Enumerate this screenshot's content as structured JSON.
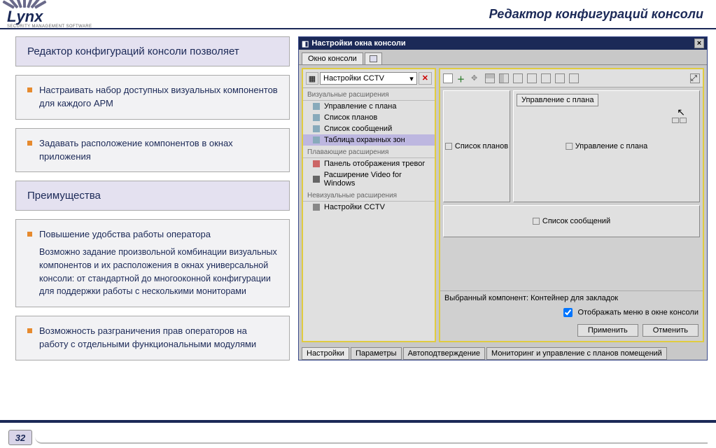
{
  "header": {
    "logo_text": "Lynx",
    "logo_sub": "SECURITY MANAGEMENT SOFTWARE",
    "title": "Редактор конфигураций консоли"
  },
  "intro_panel": "Редактор конфигураций консоли позволяет",
  "feature1": "Настраивать набор доступных визуальных компонентов для каждого АРМ",
  "feature2": "Задавать расположение компонентов в окнах приложения",
  "advantages_title": "Преимущества",
  "adv1_title": "Повышение удобства работы оператора",
  "adv1_body": "Возможно задание произвольной комбинации визуальных компонентов и их расположения в окнах универсальной консоли: от стандартной до многооконной конфигурации для поддержки работы с несколькими мониторами",
  "adv2": "Возможность разграничения прав операторов на работу с отдельными функциональными модулями",
  "app": {
    "title": "Настройки окна консоли",
    "top_tabs": {
      "t1": "Окно консоли"
    },
    "dropdown": "Настройки CCTV",
    "sections": {
      "visual": "Визуальные расширения",
      "floating": "Плавающие расширения",
      "nonvisual": "Невизуальные расширения"
    },
    "visual_items": [
      "Управление с плана",
      "Список планов",
      "Список сообщений",
      "Таблица охранных зон"
    ],
    "floating_items": [
      "Панель отображения тревог",
      "Расширение Video for Windows"
    ],
    "nonvisual_items": [
      "Настройки CCTV"
    ],
    "tab_chip": "Управление с плана",
    "cell_plans": "Список планов",
    "cell_control": "Управление с плана",
    "cell_messages": "Список сообщений",
    "selected_label": "Выбранный компонент: Контейнер для закладок",
    "checkbox": "Отображать меню в окне консоли",
    "btn_apply": "Применить",
    "btn_cancel": "Отменить",
    "bottom_tabs": [
      "Настройки",
      "Параметры",
      "Автоподтверждение",
      "Мониторинг и управление с планов помещений"
    ]
  },
  "page_number": "32"
}
